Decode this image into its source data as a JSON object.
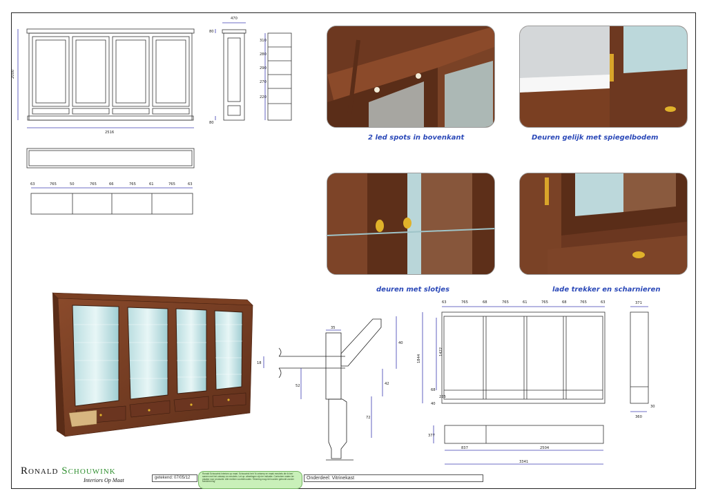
{
  "captions": {
    "c1": "2 led spots in bovenkant",
    "c2": "Deuren gelijk met spiegelbodem",
    "c3": "deuren met slotjes",
    "c4": "lade trekker en scharnieren"
  },
  "dims_top": {
    "height": "2000",
    "width": "2516",
    "depth": "470",
    "side_top": "80",
    "side_bottom": "80",
    "shelves": [
      "310",
      "280",
      "290",
      "270",
      "220"
    ],
    "plan": [
      "63",
      "765",
      "50",
      "765",
      "66",
      "765",
      "61",
      "765",
      "63"
    ]
  },
  "dims_detail": {
    "a": "35",
    "b": "40",
    "c": "18",
    "d": "52",
    "e": "42",
    "f": "72"
  },
  "dims_right": {
    "top": [
      "63",
      "765",
      "68",
      "765",
      "61",
      "765",
      "68",
      "765",
      "63"
    ],
    "height": "1844",
    "inner": "1422",
    "base1": "68",
    "base2": "225",
    "base3": "40",
    "side_w": "371",
    "side_bottom": "360",
    "side_b2": "30",
    "plan_d": "377",
    "plan1": "837",
    "plan2": "2504",
    "plan_total": "3341"
  },
  "footer": {
    "brand_first": "Ronald",
    "brand_second": "Schouwink",
    "tagline": "Interiors Op Maat",
    "date": "getekend: 07/05/12",
    "note": "Ronald Schouwink Interiors op maat. Schouwink heb 'Ik ontwerp en maak meubels die ik ken' samen met het ontwerp en meubels. Let op: afmetingen zijn ter indicatie. Controleer maten ter plaatse voor productie. Alle rechten voorbehouden. Tekening mag niet worden gebruikt zonder toestemming.",
    "subject": "Onderdeel: Vitrinekast"
  }
}
